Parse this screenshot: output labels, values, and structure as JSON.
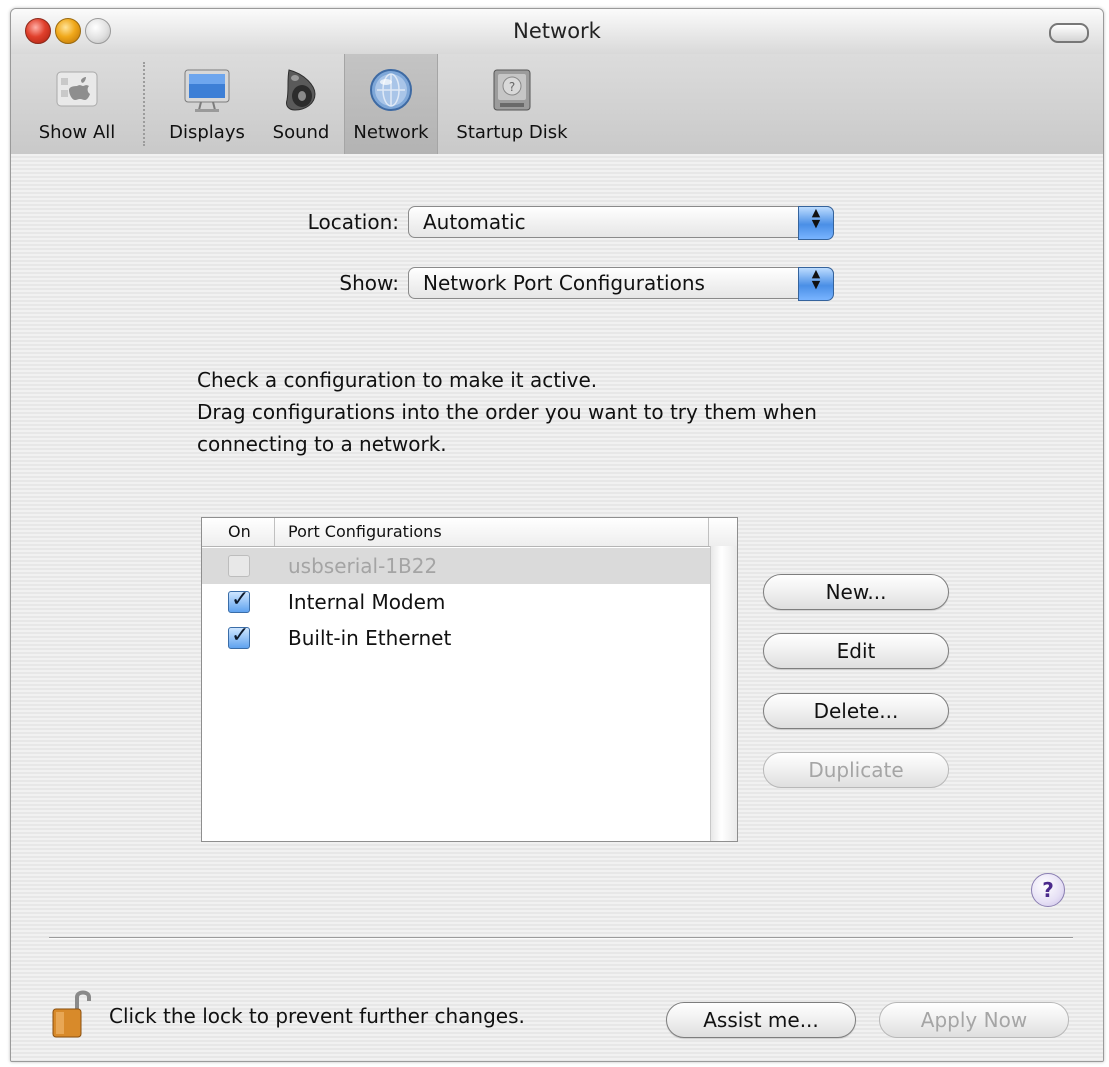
{
  "window": {
    "title": "Network"
  },
  "toolbar": {
    "items": [
      {
        "label": "Show All",
        "icon": "apple-grid-icon"
      },
      {
        "label": "Displays",
        "icon": "display-monitor-icon"
      },
      {
        "label": "Sound",
        "icon": "speaker-icon"
      },
      {
        "label": "Network",
        "icon": "network-globe-icon",
        "selected": true
      },
      {
        "label": "Startup Disk",
        "icon": "hard-disk-icon"
      }
    ]
  },
  "location": {
    "label": "Location:",
    "value": "Automatic"
  },
  "show": {
    "label": "Show:",
    "value": "Network Port Configurations"
  },
  "instructions": {
    "line1": "Check a configuration to make it active.",
    "line2": "Drag configurations into the order you want to try them when",
    "line3": "connecting to a network."
  },
  "table": {
    "columns": [
      "On",
      "Port Configurations"
    ],
    "rows": [
      {
        "name": "usbserial-1B22",
        "checked": false,
        "enabled": false
      },
      {
        "name": "Internal Modem",
        "checked": true,
        "enabled": true
      },
      {
        "name": "Built-in Ethernet",
        "checked": true,
        "enabled": true
      }
    ]
  },
  "buttons": {
    "new": "New...",
    "edit": "Edit",
    "delete": "Delete...",
    "duplicate": "Duplicate",
    "assist": "Assist me...",
    "apply": "Apply Now",
    "help": "?"
  },
  "lock": {
    "text": "Click the lock to prevent further changes."
  },
  "colors": {
    "selection_blue": "#5fa2ef",
    "window_bg": "#ececec",
    "disabled_text": "#a4a4a4"
  }
}
